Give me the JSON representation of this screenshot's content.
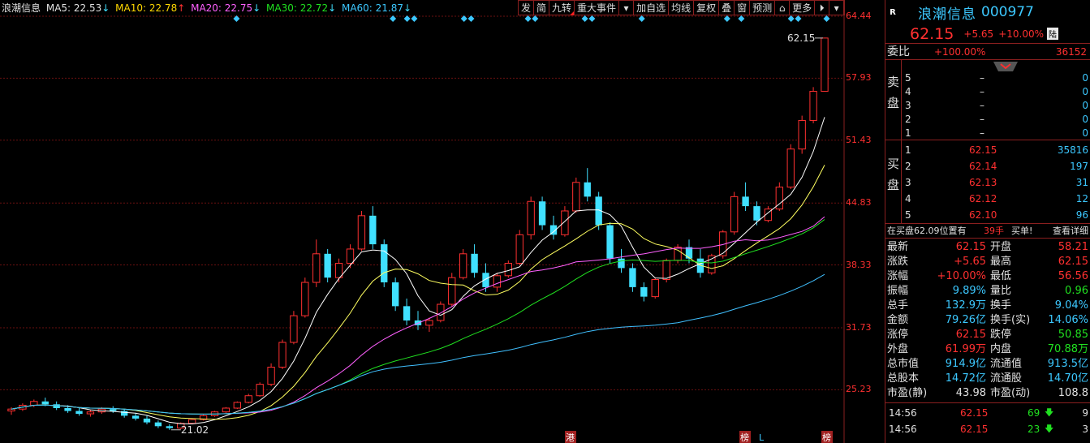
{
  "ma_legend": {
    "name": "浪潮信息",
    "ma5": "MA5: 22.53",
    "ma10": "MA10: 22.78",
    "ma20": "MA20: 22.75",
    "ma30": "MA30: 22.72",
    "ma60": "MA60: 21.87",
    "ma5_arrow": "↓",
    "ma10_arrow": "↑",
    "ma20_arrow": "↓",
    "ma30_arrow": "↓",
    "ma60_arrow": "↓"
  },
  "toolbar": {
    "items": [
      "发",
      "简",
      "九转",
      "重大事件",
      "▾",
      "加自选",
      "均线",
      "复权",
      "叠",
      "窗",
      "预测",
      "⌂",
      "更多",
      "⏵",
      "▾"
    ]
  },
  "colors": {
    "up": "#ff3030",
    "down": "#40e0ff",
    "ma5": "#ffffff",
    "ma10": "#ffff60",
    "ma20": "#ff60ff",
    "ma30": "#20e020",
    "ma60": "#40c0ff",
    "grid": "#6a1010"
  },
  "chart_data": {
    "type": "candlestick",
    "y_ticks": [
      "64.44",
      "57.93",
      "51.43",
      "44.83",
      "38.33",
      "31.73",
      "25.23"
    ],
    "ylim": [
      21.0,
      64.44
    ],
    "high_label": "62.15",
    "low_label": "21.02",
    "bottom_markers": [
      "港",
      "榜",
      "L",
      "榜"
    ],
    "candles": [
      [
        23.0,
        23.4,
        22.6,
        23.2
      ],
      [
        23.2,
        23.8,
        23.0,
        23.6
      ],
      [
        23.6,
        24.2,
        23.4,
        24.0
      ],
      [
        24.0,
        24.4,
        23.5,
        23.7
      ],
      [
        23.7,
        24.0,
        23.1,
        23.3
      ],
      [
        23.3,
        23.6,
        22.8,
        23.0
      ],
      [
        23.0,
        23.3,
        22.5,
        22.7
      ],
      [
        22.7,
        23.1,
        22.4,
        22.9
      ],
      [
        22.9,
        23.4,
        22.7,
        23.2
      ],
      [
        23.2,
        23.5,
        22.8,
        23.0
      ],
      [
        23.0,
        23.2,
        22.3,
        22.5
      ],
      [
        22.5,
        22.8,
        22.0,
        22.2
      ],
      [
        22.2,
        22.5,
        21.6,
        21.8
      ],
      [
        21.8,
        22.0,
        21.2,
        21.4
      ],
      [
        21.4,
        21.6,
        21.02,
        21.2
      ],
      [
        21.2,
        21.8,
        21.1,
        21.7
      ],
      [
        21.7,
        22.2,
        21.6,
        22.1
      ],
      [
        22.1,
        22.6,
        22.0,
        22.5
      ],
      [
        22.5,
        23.0,
        22.4,
        22.9
      ],
      [
        22.9,
        23.4,
        22.8,
        23.3
      ],
      [
        23.3,
        24.0,
        23.2,
        23.9
      ],
      [
        23.9,
        24.8,
        23.8,
        24.6
      ],
      [
        24.6,
        26.0,
        24.5,
        25.8
      ],
      [
        25.8,
        28.0,
        25.6,
        27.6
      ],
      [
        27.6,
        30.5,
        27.4,
        30.2
      ],
      [
        30.2,
        33.5,
        30.0,
        33.0
      ],
      [
        33.0,
        37.0,
        32.8,
        36.5
      ],
      [
        36.5,
        41.0,
        36.0,
        39.5
      ],
      [
        39.5,
        40.0,
        36.5,
        37.0
      ],
      [
        37.0,
        39.0,
        36.5,
        38.5
      ],
      [
        38.5,
        40.5,
        38.0,
        40.0
      ],
      [
        40.0,
        44.0,
        39.8,
        43.5
      ],
      [
        43.5,
        44.5,
        40.0,
        40.5
      ],
      [
        40.5,
        41.0,
        36.0,
        36.5
      ],
      [
        36.5,
        37.0,
        33.5,
        34.0
      ],
      [
        34.0,
        34.8,
        32.0,
        32.5
      ],
      [
        32.5,
        33.5,
        31.5,
        32.0
      ],
      [
        32.0,
        32.8,
        31.3,
        32.5
      ],
      [
        32.5,
        34.5,
        32.3,
        34.2
      ],
      [
        34.2,
        37.5,
        34.0,
        37.0
      ],
      [
        37.0,
        40.0,
        36.8,
        39.5
      ],
      [
        39.5,
        40.5,
        37.0,
        37.5
      ],
      [
        37.5,
        38.5,
        35.5,
        36.0
      ],
      [
        36.0,
        37.5,
        35.5,
        37.2
      ],
      [
        37.2,
        38.8,
        37.0,
        38.5
      ],
      [
        38.5,
        42.0,
        38.3,
        41.5
      ],
      [
        41.5,
        45.5,
        41.0,
        45.0
      ],
      [
        45.0,
        45.5,
        42.0,
        42.5
      ],
      [
        42.5,
        43.5,
        41.0,
        41.5
      ],
      [
        41.5,
        44.5,
        41.3,
        44.0
      ],
      [
        44.0,
        47.5,
        43.8,
        47.0
      ],
      [
        47.0,
        48.5,
        45.0,
        45.5
      ],
      [
        45.5,
        46.0,
        42.0,
        42.5
      ],
      [
        42.5,
        42.8,
        38.5,
        39.0
      ],
      [
        39.0,
        40.0,
        37.5,
        38.0
      ],
      [
        38.0,
        38.5,
        35.5,
        36.0
      ],
      [
        36.0,
        36.5,
        34.5,
        35.0
      ],
      [
        35.0,
        37.0,
        34.8,
        36.8
      ],
      [
        36.8,
        39.0,
        36.5,
        38.8
      ],
      [
        38.8,
        40.5,
        38.5,
        40.2
      ],
      [
        40.2,
        41.0,
        38.5,
        39.0
      ],
      [
        39.0,
        40.0,
        37.0,
        37.5
      ],
      [
        37.5,
        39.5,
        37.3,
        39.3
      ],
      [
        39.3,
        42.0,
        39.0,
        41.8
      ],
      [
        41.8,
        46.0,
        41.5,
        45.5
      ],
      [
        45.5,
        47.0,
        44.0,
        44.5
      ],
      [
        44.5,
        45.0,
        42.5,
        43.0
      ],
      [
        43.0,
        44.5,
        42.8,
        44.2
      ],
      [
        44.2,
        47.0,
        44.0,
        46.5
      ],
      [
        46.5,
        51.0,
        46.3,
        50.5
      ],
      [
        50.5,
        54.0,
        50.0,
        53.5
      ],
      [
        53.5,
        57.0,
        53.2,
        56.56
      ],
      [
        56.56,
        62.15,
        56.56,
        62.15
      ]
    ]
  },
  "right_panel": {
    "r_badge": "R",
    "name": "浪潮信息",
    "code": "000977",
    "price": "62.15",
    "change": "+5.65",
    "pct": "+10.00%",
    "exchange": "陆",
    "weibi_label": "委比",
    "weibi_value": "+100.00%",
    "weibi_vol": "36152",
    "sell_label": "卖盘",
    "buy_label": "买盘",
    "asks": [
      {
        "lvl": "5",
        "price": "–",
        "vol": "0"
      },
      {
        "lvl": "4",
        "price": "–",
        "vol": "0"
      },
      {
        "lvl": "3",
        "price": "–",
        "vol": "0"
      },
      {
        "lvl": "2",
        "price": "–",
        "vol": "0"
      },
      {
        "lvl": "1",
        "price": "–",
        "vol": "0"
      }
    ],
    "bids": [
      {
        "lvl": "1",
        "price": "62.15",
        "vol": "35816"
      },
      {
        "lvl": "2",
        "price": "62.14",
        "vol": "197"
      },
      {
        "lvl": "3",
        "price": "62.13",
        "vol": "31"
      },
      {
        "lvl": "4",
        "price": "62.12",
        "vol": "12"
      },
      {
        "lvl": "5",
        "price": "62.10",
        "vol": "96"
      }
    ],
    "queue_text": "在买盘62.09位置有",
    "queue_vol": "39手",
    "queue_action": "买单!",
    "queue_link": "查看详细",
    "stats": [
      {
        "l1": "最新",
        "v1": "62.15",
        "c1": "red",
        "l2": "开盘",
        "v2": "58.21",
        "c2": "red"
      },
      {
        "l1": "涨跌",
        "v1": "+5.65",
        "c1": "red",
        "l2": "最高",
        "v2": "62.15",
        "c2": "red"
      },
      {
        "l1": "涨幅",
        "v1": "+10.00%",
        "c1": "red",
        "l2": "最低",
        "v2": "56.56",
        "c2": "red"
      },
      {
        "l1": "振幅",
        "v1": "9.89%",
        "c1": "cyan",
        "l2": "量比",
        "v2": "0.96",
        "c2": "green"
      },
      {
        "l1": "总手",
        "v1": "132.9万",
        "c1": "cyan",
        "l2": "换手",
        "v2": "9.04%",
        "c2": "cyan"
      },
      {
        "l1": "金额",
        "v1": "79.26亿",
        "c1": "cyan",
        "l2": "换手(实)",
        "v2": "14.06%",
        "c2": "cyan"
      },
      {
        "l1": "涨停",
        "v1": "62.15",
        "c1": "red",
        "l2": "跌停",
        "v2": "50.85",
        "c2": "green"
      },
      {
        "l1": "外盘",
        "v1": "61.99万",
        "c1": "red",
        "l2": "内盘",
        "v2": "70.88万",
        "c2": "green"
      },
      {
        "l1": "总市值",
        "v1": "914.9亿",
        "c1": "cyan",
        "l2": "流通值",
        "v2": "913.5亿",
        "c2": "cyan"
      },
      {
        "l1": "总股本",
        "v1": "14.72亿",
        "c1": "cyan",
        "l2": "流通股",
        "v2": "14.70亿",
        "c2": "cyan"
      },
      {
        "l1": "市盈(静)",
        "v1": "43.98",
        "c1": "white",
        "l2": "市盈(动)",
        "v2": "108.8",
        "c2": "white"
      }
    ],
    "ticks": [
      {
        "time": "14:56",
        "price": "62.15",
        "vol": "69",
        "arrow": "🡇",
        "n": "9"
      },
      {
        "time": "14:56",
        "price": "62.15",
        "vol": "23",
        "arrow": "🡇",
        "n": "3"
      }
    ]
  }
}
